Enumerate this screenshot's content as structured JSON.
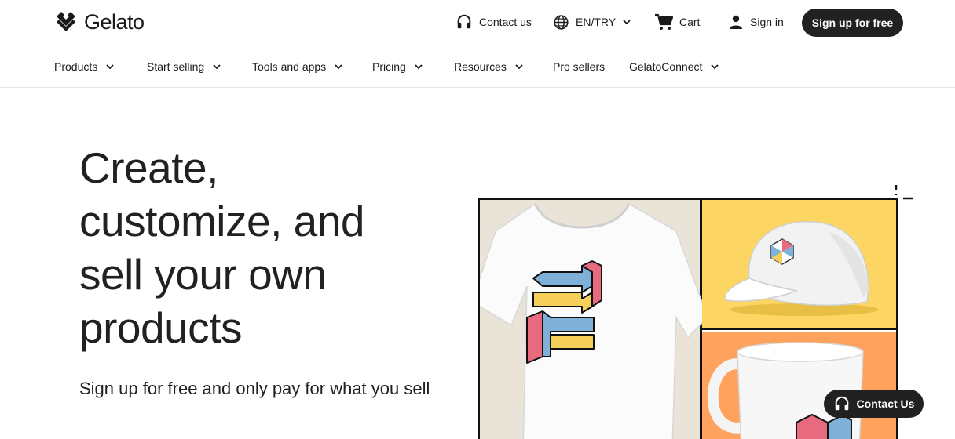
{
  "brand": {
    "name": "Gelato"
  },
  "header": {
    "contact_label": "Contact us",
    "language_label": "EN/TRY",
    "cart_label": "Cart",
    "signin_label": "Sign in",
    "signup_label": "Sign up for free"
  },
  "nav": {
    "items": [
      {
        "label": "Products",
        "has_dropdown": true
      },
      {
        "label": "Start selling",
        "has_dropdown": true
      },
      {
        "label": "Tools and apps",
        "has_dropdown": true
      },
      {
        "label": "Pricing",
        "has_dropdown": true
      },
      {
        "label": "Resources",
        "has_dropdown": true
      },
      {
        "label": "Pro sellers",
        "has_dropdown": false
      },
      {
        "label": "GelatoConnect",
        "has_dropdown": true
      }
    ]
  },
  "hero": {
    "title_lines": [
      "Create,",
      "customize, and",
      "sell your own",
      "products"
    ],
    "subtitle": "Sign up for free and only pay for what you sell"
  },
  "floating": {
    "contact_label": "Contact Us"
  },
  "colors": {
    "primary_dark": "#212121",
    "panel_beige": "#e9e3d8",
    "panel_yellow": "#fcd563",
    "panel_orange": "#ffa25e",
    "art_blue": "#7fb0d8",
    "art_pink": "#e86a7e",
    "art_yellow": "#f5cf5a"
  },
  "icons": [
    "logo-mark-icon",
    "headset-icon",
    "globe-icon",
    "chevron-down-icon",
    "cart-icon",
    "user-icon"
  ]
}
